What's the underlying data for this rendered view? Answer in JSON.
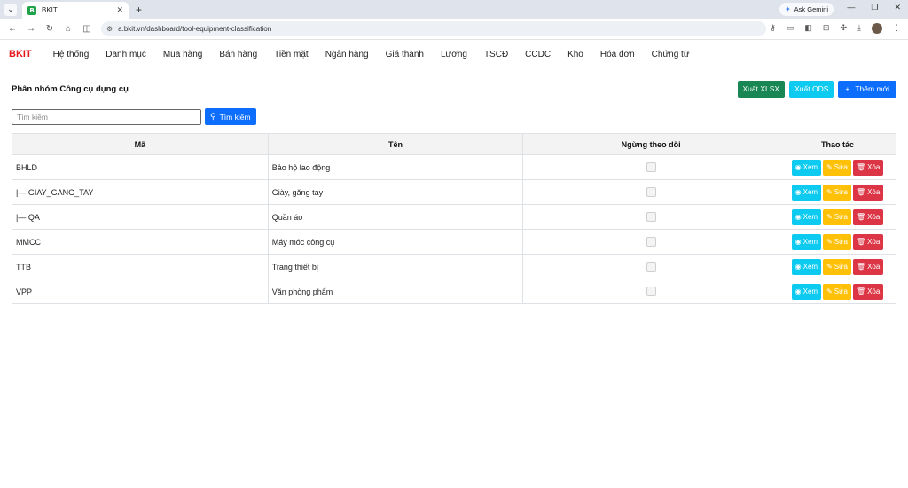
{
  "browser": {
    "tab_favicon": "B",
    "tab_title": "BKIT",
    "gemini_label": "Ask Gemini",
    "url": "a.bkit.vn/dashboard/tool-equipment-classification"
  },
  "app": {
    "brand": "BKIT",
    "menu": [
      "Hệ thống",
      "Danh mục",
      "Mua hàng",
      "Bán hàng",
      "Tiền mặt",
      "Ngân hàng",
      "Giá thành",
      "Lương",
      "TSCĐ",
      "CCDC",
      "Kho",
      "Hóa đơn",
      "Chứng từ"
    ]
  },
  "page": {
    "title": "Phân nhóm Công cụ dụng cụ",
    "export_xlsx": "Xuất XLSX",
    "export_ods": "Xuất ODS",
    "add_new": "Thêm mới",
    "search_placeholder": "Tìm kiếm",
    "search_button": "Tìm kiếm"
  },
  "table": {
    "headers": [
      "Mã",
      "Tên",
      "Ngừng theo dõi",
      "Thao tác"
    ],
    "action_labels": {
      "view": "Xem",
      "edit": "Sửa",
      "delete": "Xóa"
    },
    "rows": [
      {
        "code": "BHLD",
        "name": "Bảo hộ lao động",
        "inactive": false
      },
      {
        "code": "|— GIAY_GANG_TAY",
        "name": "Giày, găng tay",
        "inactive": false
      },
      {
        "code": "|— QA",
        "name": "Quần áo",
        "inactive": false
      },
      {
        "code": "MMCC",
        "name": "Máy móc công cụ",
        "inactive": false
      },
      {
        "code": "TTB",
        "name": "Trang thiết bị",
        "inactive": false
      },
      {
        "code": "VPP",
        "name": "Văn phòng phẩm",
        "inactive": false
      }
    ]
  },
  "colors": {
    "brand": "#e4161b",
    "primary": "#0d6efd",
    "success": "#198754",
    "info": "#0dcaf0",
    "warning": "#ffc107",
    "danger": "#dc3545"
  }
}
